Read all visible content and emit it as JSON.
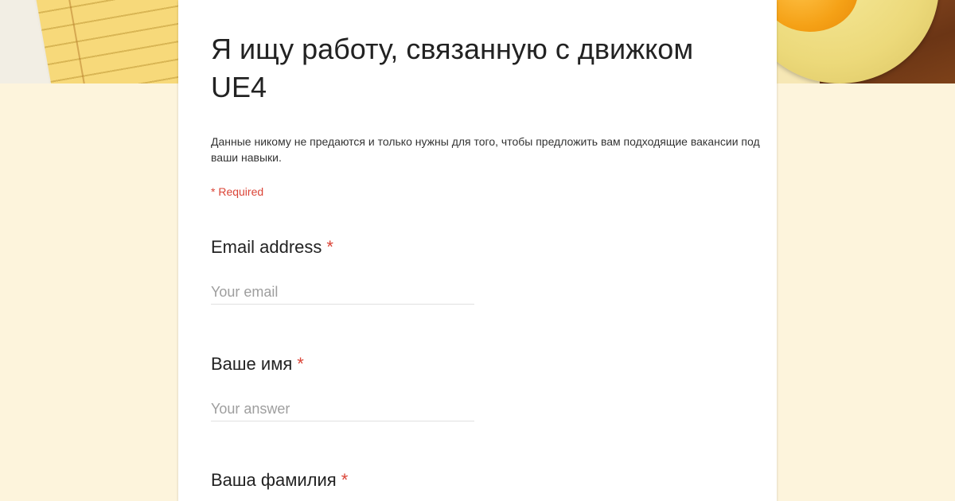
{
  "form": {
    "title": "Я ищу работу, связанную с движком UE4",
    "description": "Данные никому не предаются и только нужны для того, чтобы предложить вам подходящие вакансии под ваши навыки.",
    "required_note": "* Required",
    "questions": [
      {
        "label": "Email address",
        "required_mark": "*",
        "placeholder": "Your email",
        "value": ""
      },
      {
        "label": "Ваше имя",
        "required_mark": "*",
        "placeholder": "Your answer",
        "value": ""
      },
      {
        "label": "Ваша фамилия",
        "required_mark": "*"
      }
    ]
  },
  "colors": {
    "page_background": "#fdf4dc",
    "required_red": "#db4437",
    "card_background": "#ffffff"
  },
  "header": {
    "decor_left": "notepad-and-paper-illustration",
    "decor_right": "orange-on-plate-illustration"
  }
}
